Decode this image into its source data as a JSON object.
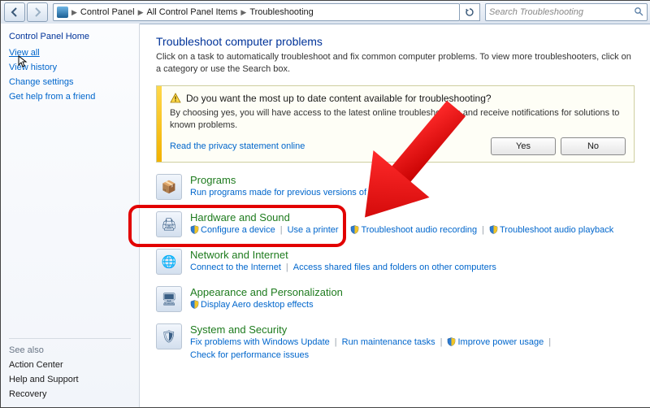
{
  "breadcrumb": [
    "Control Panel",
    "All Control Panel Items",
    "Troubleshooting"
  ],
  "search_placeholder": "Search Troubleshooting",
  "sidebar": {
    "home": "Control Panel Home",
    "links": [
      "View all",
      "View history",
      "Change settings",
      "Get help from a friend"
    ],
    "see_also_title": "See also",
    "see_also": [
      "Action Center",
      "Help and Support",
      "Recovery"
    ]
  },
  "main": {
    "heading": "Troubleshoot computer problems",
    "description": "Click on a task to automatically troubleshoot and fix common computer problems. To view more troubleshooters, click on a category or use the Search box."
  },
  "infobox": {
    "title": "Do you want the most up to date content available for troubleshooting?",
    "text": "By choosing yes, you will have access to the latest online troubleshooters and receive notifications for solutions to known problems.",
    "privacy": "Read the privacy statement online",
    "yes": "Yes",
    "no": "No"
  },
  "categories": [
    {
      "title": "Programs",
      "icon": "📦",
      "links": [
        {
          "label": "Run programs made for previous versions of Windows",
          "shield": false
        }
      ]
    },
    {
      "title": "Hardware and Sound",
      "icon": "🖨",
      "links": [
        {
          "label": "Configure a device",
          "shield": true
        },
        {
          "label": "Use a printer",
          "shield": false
        },
        {
          "label": "Troubleshoot audio recording",
          "shield": true
        },
        {
          "label": "Troubleshoot audio playback",
          "shield": true
        }
      ]
    },
    {
      "title": "Network and Internet",
      "icon": "🌐",
      "links": [
        {
          "label": "Connect to the Internet",
          "shield": false
        },
        {
          "label": "Access shared files and folders on other computers",
          "shield": false
        }
      ]
    },
    {
      "title": "Appearance and Personalization",
      "icon": "🖥",
      "links": [
        {
          "label": "Display Aero desktop effects",
          "shield": true
        }
      ]
    },
    {
      "title": "System and Security",
      "icon": "🛡",
      "links": [
        {
          "label": "Fix problems with Windows Update",
          "shield": false
        },
        {
          "label": "Run maintenance tasks",
          "shield": false
        },
        {
          "label": "Improve power usage",
          "shield": true
        },
        {
          "label": "Check for performance issues",
          "shield": false
        }
      ]
    }
  ]
}
